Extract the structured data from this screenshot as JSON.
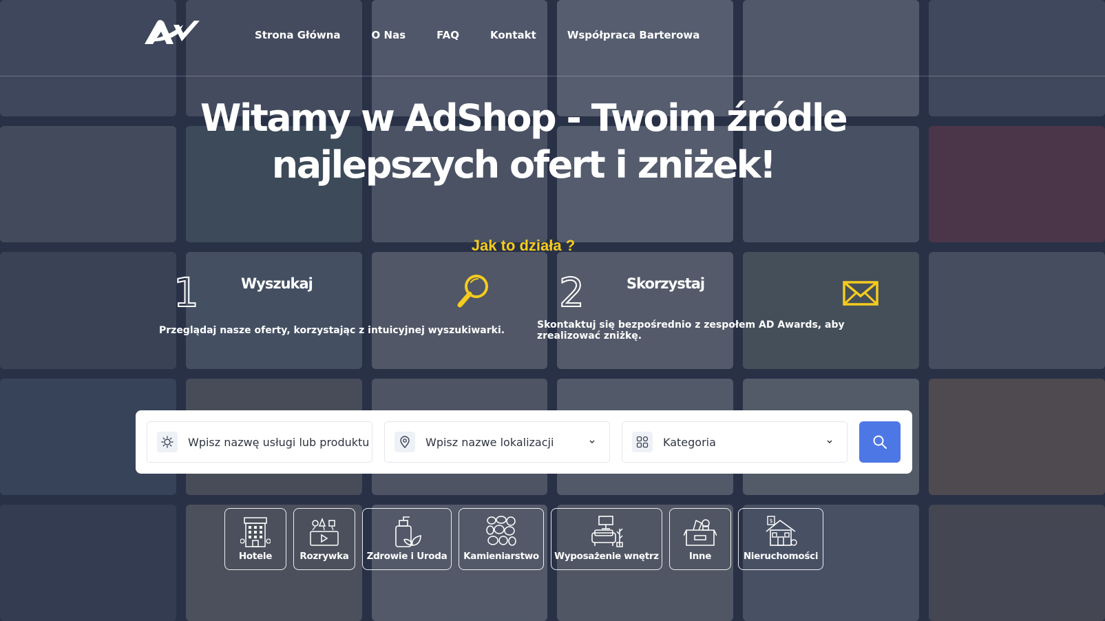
{
  "colors": {
    "accent_yellow": "#f5cc1d",
    "search_button": "#4e77e6",
    "overlay": "#283248"
  },
  "header": {
    "logo_name": "AD logo",
    "nav": [
      {
        "label": "Strona Główna"
      },
      {
        "label": "O Nas"
      },
      {
        "label": "FAQ"
      },
      {
        "label": "Kontakt"
      },
      {
        "label": "Współpraca Barterowa"
      }
    ]
  },
  "hero": {
    "title_line1": "Witamy w AdShop - Twoim źródle",
    "title_line2": "najlepszych ofert i zniżek!"
  },
  "how_it_works": {
    "title": "Jak to działa ?",
    "steps": [
      {
        "number": "1",
        "title": "Wyszukaj",
        "description": "Przeglądaj nasze oferty, korzystając z intuicyjnej wyszukiwarki.",
        "icon": "magnifier-icon"
      },
      {
        "number": "2",
        "title": "Skorzystaj",
        "description_line1": "Skontaktuj się bezpośrednio z zespołem AD Awards, aby",
        "description_line2": "zrealizować zniżkę.",
        "icon": "envelope-icon"
      }
    ]
  },
  "search": {
    "service_placeholder": "Wpisz nazwę usługi lub produktu",
    "location_placeholder": "Wpisz nazwe lokalizacji",
    "category_placeholder": "Kategoria"
  },
  "categories": [
    {
      "label": "Hotele",
      "icon": "hotel-icon"
    },
    {
      "label": "Rozrywka",
      "icon": "entertainment-icon"
    },
    {
      "label": "Zdrowie i Uroda",
      "icon": "health-beauty-icon"
    },
    {
      "label": "Kamieniarstwo",
      "icon": "stones-icon"
    },
    {
      "label": "Wyposażenie wnętrz",
      "icon": "interior-icon"
    },
    {
      "label": "Inne",
      "icon": "box-icon"
    },
    {
      "label": "Nieruchomości",
      "icon": "real-estate-icon"
    }
  ]
}
